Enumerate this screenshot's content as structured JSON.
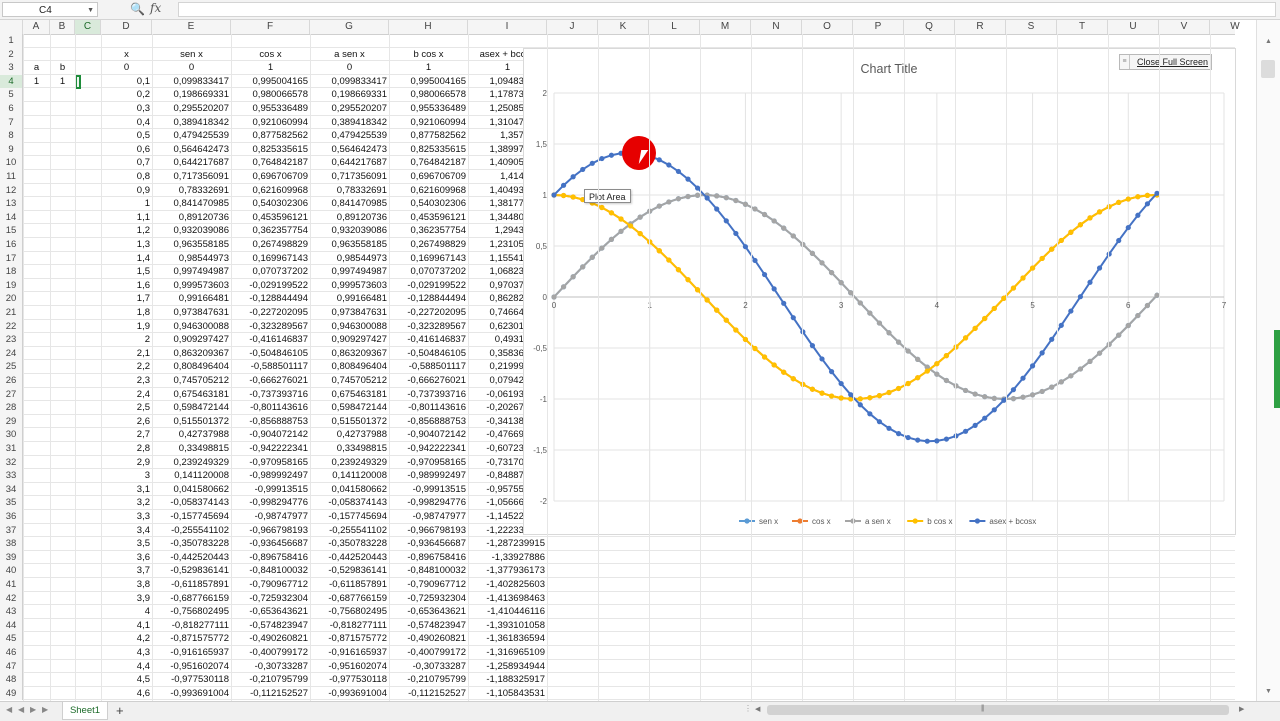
{
  "formula_bar": {
    "name_box": "C4",
    "function_label": "fx",
    "formula": ""
  },
  "columns": [
    "A",
    "B",
    "C",
    "D",
    "E",
    "F",
    "G",
    "H",
    "I",
    "J",
    "K",
    "L",
    "M",
    "N",
    "O",
    "P",
    "Q",
    "R",
    "S",
    "T",
    "U",
    "V",
    "W"
  ],
  "header_labels": {
    "x": "x",
    "sen": "sen x",
    "cos": "cos x",
    "asen": "a sen x",
    "bcos": "b cos x",
    "sum": "asex + bcosx"
  },
  "params": {
    "a_label": "a",
    "b_label": "b",
    "a_value": "1",
    "b_value": "1"
  },
  "first_row_number": 1,
  "table_rows": [
    [
      "0",
      "0",
      "1",
      "0",
      "1",
      "1"
    ],
    [
      "0,1",
      "0,099833417",
      "0,995004165",
      "0,099833417",
      "0,995004165",
      "1,094837582"
    ],
    [
      "0,2",
      "0,198669331",
      "0,980066578",
      "0,198669331",
      "0,980066578",
      "1,178735909"
    ],
    [
      "0,3",
      "0,295520207",
      "0,955336489",
      "0,295520207",
      "0,955336489",
      "1,250856696"
    ],
    [
      "0,4",
      "0,389418342",
      "0,921060994",
      "0,389418342",
      "0,921060994",
      "1,310479336"
    ],
    [
      "0,5",
      "0,479425539",
      "0,877582562",
      "0,479425539",
      "0,877582562",
      "1,3570081"
    ],
    [
      "0,6",
      "0,564642473",
      "0,825335615",
      "0,564642473",
      "0,825335615",
      "1,389978088"
    ],
    [
      "0,7",
      "0,644217687",
      "0,764842187",
      "0,644217687",
      "0,764842187",
      "1,409059875"
    ],
    [
      "0,8",
      "0,717356091",
      "0,696706709",
      "0,717356091",
      "0,696706709",
      "1,4140628"
    ],
    [
      "0,9",
      "0,78332691",
      "0,621609968",
      "0,78332691",
      "0,621609968",
      "1,404936878"
    ],
    [
      "1",
      "0,841470985",
      "0,540302306",
      "0,841470985",
      "0,540302306",
      "1,381773291"
    ],
    [
      "1,1",
      "0,89120736",
      "0,453596121",
      "0,89120736",
      "0,453596121",
      "1,344803481"
    ],
    [
      "1,2",
      "0,932039086",
      "0,362357754",
      "0,932039086",
      "0,362357754",
      "1,29439684"
    ],
    [
      "1,3",
      "0,963558185",
      "0,267498829",
      "0,963558185",
      "0,267498829",
      "1,231057014"
    ],
    [
      "1,4",
      "0,98544973",
      "0,169967143",
      "0,98544973",
      "0,169967143",
      "1,155416873"
    ],
    [
      "1,5",
      "0,997494987",
      "0,070737202",
      "0,997494987",
      "0,070737202",
      "1,068232188"
    ],
    [
      "1,6",
      "0,999573603",
      "-0,029199522",
      "0,999573603",
      "-0,029199522",
      "0,970374081"
    ],
    [
      "1,7",
      "0,99166481",
      "-0,128844494",
      "0,99166481",
      "-0,128844494",
      "0,862820316"
    ],
    [
      "1,8",
      "0,973847631",
      "-0,227202095",
      "0,973847631",
      "-0,227202095",
      "0,746645536"
    ],
    [
      "1,9",
      "0,946300088",
      "-0,323289567",
      "0,946300088",
      "-0,323289567",
      "0,623010521"
    ],
    [
      "2",
      "0,909297427",
      "-0,416146837",
      "0,909297427",
      "-0,416146837",
      "0,49315059"
    ],
    [
      "2,1",
      "0,863209367",
      "-0,504846105",
      "0,863209367",
      "-0,504846105",
      "0,358363262"
    ],
    [
      "2,2",
      "0,808496404",
      "-0,588501117",
      "0,808496404",
      "-0,588501117",
      "0,219995287"
    ],
    [
      "2,3",
      "0,745705212",
      "-0,666276021",
      "0,745705212",
      "-0,666276021",
      "0,079429191"
    ],
    [
      "2,4",
      "0,675463181",
      "-0,737393716",
      "0,675463181",
      "-0,737393716",
      "-0,061930535"
    ],
    [
      "2,5",
      "0,598472144",
      "-0,801143616",
      "0,598472144",
      "-0,801143616",
      "-0,202671471"
    ],
    [
      "2,6",
      "0,515501372",
      "-0,856888753",
      "0,515501372",
      "-0,856888753",
      "-0,341387382"
    ],
    [
      "2,7",
      "0,42737988",
      "-0,904072142",
      "0,42737988",
      "-0,904072142",
      "-0,476692262"
    ],
    [
      "2,8",
      "0,33498815",
      "-0,942222341",
      "0,33498815",
      "-0,942222341",
      "-0,607234191"
    ],
    [
      "2,9",
      "0,239249329",
      "-0,970958165",
      "0,239249329",
      "-0,970958165",
      "-0,731708836"
    ],
    [
      "3",
      "0,141120008",
      "-0,989992497",
      "0,141120008",
      "-0,989992497",
      "-0,848872489"
    ],
    [
      "3,1",
      "0,041580662",
      "-0,99913515",
      "0,041580662",
      "-0,99913515",
      "-0,957554488"
    ],
    [
      "3,2",
      "-0,058374143",
      "-0,998294776",
      "-0,058374143",
      "-0,998294776",
      "-1,056668919"
    ],
    [
      "3,3",
      "-0,157745694",
      "-0,98747977",
      "-0,157745694",
      "-0,98747977",
      "-1,145225464"
    ],
    [
      "3,4",
      "-0,255541102",
      "-0,966798193",
      "-0,255541102",
      "-0,966798193",
      "-1,222339295"
    ],
    [
      "3,5",
      "-0,350783228",
      "-0,936456687",
      "-0,350783228",
      "-0,936456687",
      "-1,287239915"
    ],
    [
      "3,6",
      "-0,442520443",
      "-0,896758416",
      "-0,442520443",
      "-0,896758416",
      "-1,33927886"
    ],
    [
      "3,7",
      "-0,529836141",
      "-0,848100032",
      "-0,529836141",
      "-0,848100032",
      "-1,377936173"
    ],
    [
      "3,8",
      "-0,611857891",
      "-0,790967712",
      "-0,611857891",
      "-0,790967712",
      "-1,402825603"
    ],
    [
      "3,9",
      "-0,687766159",
      "-0,725932304",
      "-0,687766159",
      "-0,725932304",
      "-1,413698463"
    ],
    [
      "4",
      "-0,756802495",
      "-0,653643621",
      "-0,756802495",
      "-0,653643621",
      "-1,410446116"
    ],
    [
      "4,1",
      "-0,818277111",
      "-0,574823947",
      "-0,818277111",
      "-0,574823947",
      "-1,393101058"
    ],
    [
      "4,2",
      "-0,871575772",
      "-0,490260821",
      "-0,871575772",
      "-0,490260821",
      "-1,361836594"
    ],
    [
      "4,3",
      "-0,916165937",
      "-0,400799172",
      "-0,916165937",
      "-0,400799172",
      "-1,316965109"
    ],
    [
      "4,4",
      "-0,951602074",
      "-0,30733287",
      "-0,951602074",
      "-0,30733287",
      "-1,258934944"
    ],
    [
      "4,5",
      "-0,977530118",
      "-0,210795799",
      "-0,977530118",
      "-0,210795799",
      "-1,188325917"
    ],
    [
      "4,6",
      "-0,993691004",
      "-0,112152527",
      "-0,993691004",
      "-0,112152527",
      "-1,105843531"
    ]
  ],
  "chart_data": {
    "type": "line",
    "title": "Chart Title",
    "xlim": [
      0,
      7
    ],
    "ylim": [
      -2,
      2
    ],
    "x_ticks": [
      "0",
      "1",
      "2",
      "3",
      "4",
      "5",
      "6",
      "7"
    ],
    "y_ticks": [
      "2",
      "1,5",
      "1",
      "0,5",
      "0",
      "-0,5",
      "-1",
      "-1,5",
      "-2"
    ],
    "x_step": 0.1,
    "x_count": 64,
    "grid": true,
    "legend_position": "bottom",
    "series": [
      {
        "name": "sen x",
        "function": "sin",
        "color": "#5b9bd5"
      },
      {
        "name": "cos x",
        "function": "cos",
        "color": "#ed7d31"
      },
      {
        "name": "a sen x",
        "function": "sin",
        "color": "#a5a5a5"
      },
      {
        "name": "b cos x",
        "function": "cos",
        "color": "#ffc000"
      },
      {
        "name": "asex + bcosx",
        "function": "sin+cos",
        "color": "#4472c4"
      }
    ],
    "draw_order": [
      "sen x",
      "cos x",
      "a sen x",
      "b cos x",
      "asex + bcosx"
    ]
  },
  "chart_ui": {
    "close_full_screen": "Close Full Screen",
    "tooltip": "Plot Area"
  },
  "sheet_tabs": [
    "Sheet1"
  ],
  "add_sheet": "+",
  "accent_color": "#1e8c3a"
}
